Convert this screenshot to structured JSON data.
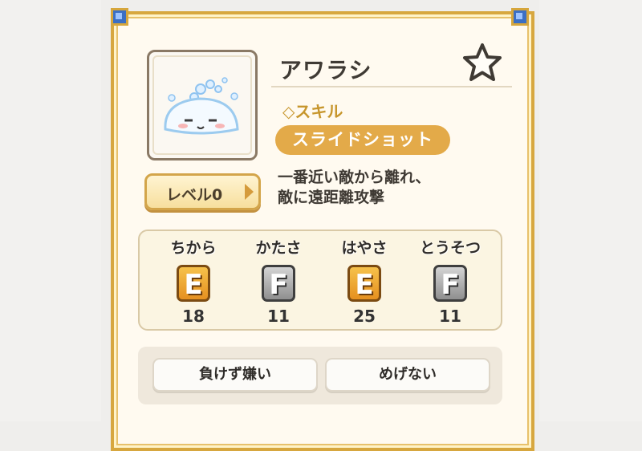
{
  "character": {
    "name": "アワラシ",
    "skill_label": "◇スキル",
    "skill_name": "スライドショット",
    "description": "一番近い敵から離れ、\n敵に遠距離攻撃",
    "level_label": "レベル0",
    "favorite_icon": "star-icon"
  },
  "stats": [
    {
      "name": "ちから",
      "rank": "E",
      "value": "18"
    },
    {
      "name": "かたさ",
      "rank": "F",
      "value": "11"
    },
    {
      "name": "はやさ",
      "rank": "E",
      "value": "25"
    },
    {
      "name": "とうそつ",
      "rank": "F",
      "value": "11"
    }
  ],
  "traits": [
    "負けず嫌い",
    "めげない"
  ],
  "colors": {
    "frame_gold": "#d7a73f",
    "skill_pill": "#e3aa49",
    "rank_E": "#f0a830",
    "rank_F": "#a8a8a8"
  }
}
